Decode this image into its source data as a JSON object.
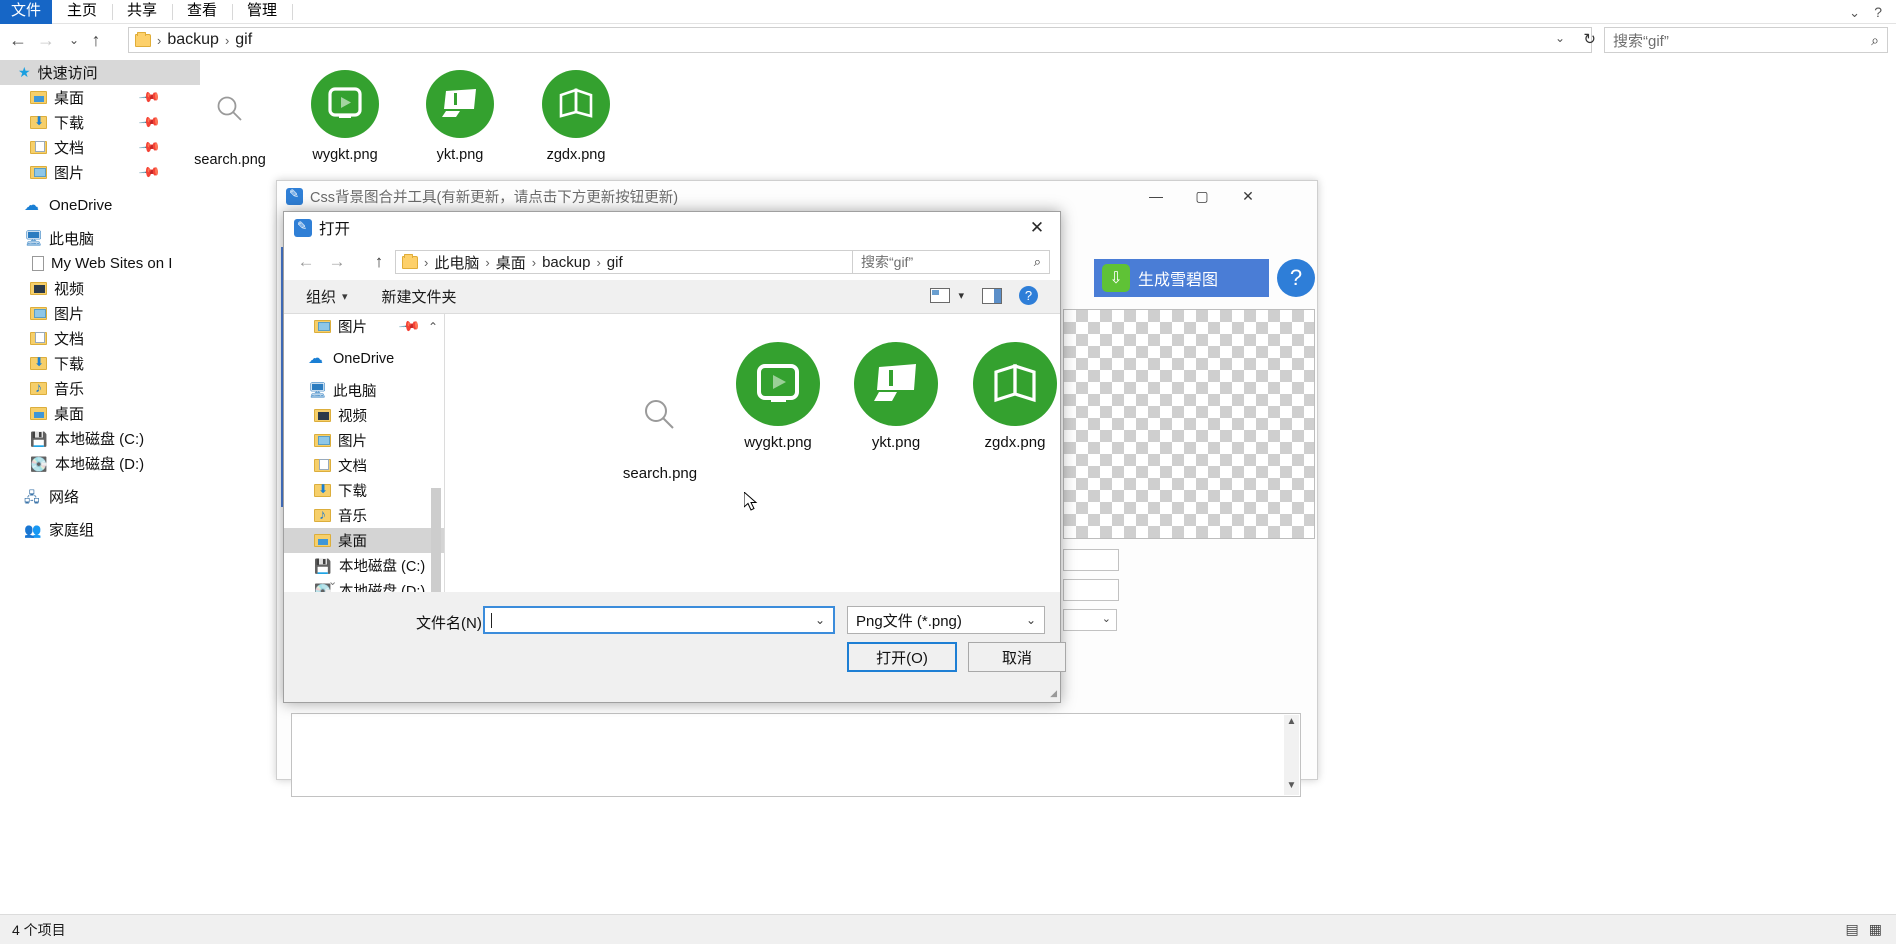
{
  "explorer": {
    "ribbon_tabs": [
      {
        "label": "文件",
        "active": true
      },
      {
        "label": "主页",
        "active": false
      },
      {
        "label": "共享",
        "active": false
      },
      {
        "label": "查看",
        "active": false
      },
      {
        "label": "管理",
        "active": false
      }
    ],
    "nav": {
      "back_icon": "←",
      "forward_icon": "→",
      "recent_icon": "⌄",
      "up_icon": "↑"
    },
    "breadcrumb": [
      "backup",
      "gif"
    ],
    "address_caret": "⌄",
    "refresh_icon": "↻",
    "search_placeholder": "搜索“gif”",
    "search_icon": "⌕",
    "sidebar": [
      {
        "label": "快速访问",
        "icon": "star-icon",
        "selected": true,
        "indent": 0
      },
      {
        "label": "桌面",
        "icon": "folder-desktop-icon",
        "pinned": true,
        "indent": 1
      },
      {
        "label": "下载",
        "icon": "folder-downloads-icon",
        "pinned": true,
        "indent": 1
      },
      {
        "label": "文档",
        "icon": "folder-documents-icon",
        "pinned": true,
        "indent": 1
      },
      {
        "label": "图片",
        "icon": "folder-pictures-icon",
        "pinned": true,
        "indent": 1
      },
      {
        "label": "OneDrive",
        "icon": "cloud-icon",
        "indent": 0
      },
      {
        "label": "此电脑",
        "icon": "pc-icon",
        "indent": 0
      },
      {
        "label": "My Web Sites on I",
        "icon": "page-icon",
        "indent": 1
      },
      {
        "label": "视频",
        "icon": "folder-videos-icon",
        "indent": 1
      },
      {
        "label": "图片",
        "icon": "folder-pictures-icon",
        "indent": 1
      },
      {
        "label": "文档",
        "icon": "folder-documents-icon",
        "indent": 1
      },
      {
        "label": "下载",
        "icon": "folder-downloads-icon",
        "indent": 1
      },
      {
        "label": "音乐",
        "icon": "folder-music-icon",
        "indent": 1
      },
      {
        "label": "桌面",
        "icon": "folder-desktop-icon",
        "indent": 1
      },
      {
        "label": "本地磁盘 (C:)",
        "icon": "disk-windows-icon",
        "indent": 1
      },
      {
        "label": "本地磁盘 (D:)",
        "icon": "disk-icon",
        "indent": 1
      },
      {
        "label": "网络",
        "icon": "network-icon",
        "indent": 0
      },
      {
        "label": "家庭组",
        "icon": "homegroup-icon",
        "indent": 0
      }
    ],
    "files": [
      {
        "name": "search.png",
        "icon": "magnifier-thumbnail"
      },
      {
        "name": "wygkt.png",
        "icon": "green-play-circle"
      },
      {
        "name": "ykt.png",
        "icon": "green-screen-circle"
      },
      {
        "name": "zgdx.png",
        "icon": "green-book-circle"
      }
    ],
    "status": {
      "item_count": "4 个项目",
      "view_details_icon": "▤",
      "view_tiles_icon": "▦"
    }
  },
  "app_window": {
    "title": "Css背景图合并工具(有新更新，请点击下方更新按钮更新)",
    "icon": "app-pencil-icon",
    "minimize": "—",
    "maximize": "▢",
    "close": "✕",
    "generate_button": {
      "label": "生成雪碧图",
      "icon": "download-arrow-icon"
    },
    "help_button": "?"
  },
  "dialog": {
    "title": "打开",
    "icon": "app-pencil-icon",
    "close": "✕",
    "nav": {
      "back_icon": "←",
      "forward_icon": "→",
      "up_icon": "↑"
    },
    "breadcrumb": [
      "此电脑",
      "桌面",
      "backup",
      "gif"
    ],
    "address_caret": "⌄",
    "refresh_icon": "↻",
    "search_placeholder": "搜索“gif”",
    "search_icon": "⌕",
    "toolbar": {
      "organize_label": "组织",
      "organize_caret": "▾",
      "new_folder_label": "新建文件夹",
      "view_caret": "▾",
      "help_icon": "?"
    },
    "sidebar": [
      {
        "label": "图片",
        "icon": "folder-pictures-icon",
        "pinned": true,
        "indent": 1
      },
      {
        "label": "OneDrive",
        "icon": "cloud-icon",
        "indent": 0
      },
      {
        "label": "此电脑",
        "icon": "pc-icon",
        "indent": 0
      },
      {
        "label": "视频",
        "icon": "folder-videos-icon",
        "indent": 1
      },
      {
        "label": "图片",
        "icon": "folder-pictures-icon",
        "indent": 1
      },
      {
        "label": "文档",
        "icon": "folder-documents-icon",
        "indent": 1
      },
      {
        "label": "下载",
        "icon": "folder-downloads-icon",
        "indent": 1
      },
      {
        "label": "音乐",
        "icon": "folder-music-icon",
        "indent": 1
      },
      {
        "label": "桌面",
        "icon": "folder-desktop-icon",
        "indent": 1,
        "selected": true
      },
      {
        "label": "本地磁盘 (C:)",
        "icon": "disk-windows-icon",
        "indent": 1
      },
      {
        "label": "本地磁盘 (D:)",
        "icon": "disk-icon",
        "indent": 1
      }
    ],
    "files": [
      {
        "name": "search.png",
        "icon": "magnifier-thumbnail"
      },
      {
        "name": "wygkt.png",
        "icon": "green-play-circle"
      },
      {
        "name": "ykt.png",
        "icon": "green-screen-circle"
      },
      {
        "name": "zgdx.png",
        "icon": "green-book-circle"
      }
    ],
    "filename_label": "文件名(N):",
    "filename_value": "",
    "filter_value": "Png文件 (*.png)",
    "filter_caret": "⌄",
    "open_button": "打开(O)",
    "cancel_button": "取消"
  },
  "colors": {
    "ribbon_active": "#1666c6",
    "accent_blue": "#4a7dd6",
    "green_icon": "#34a12f",
    "focus_border": "#3b8cdb",
    "selection_blue": "#cde8ff"
  }
}
